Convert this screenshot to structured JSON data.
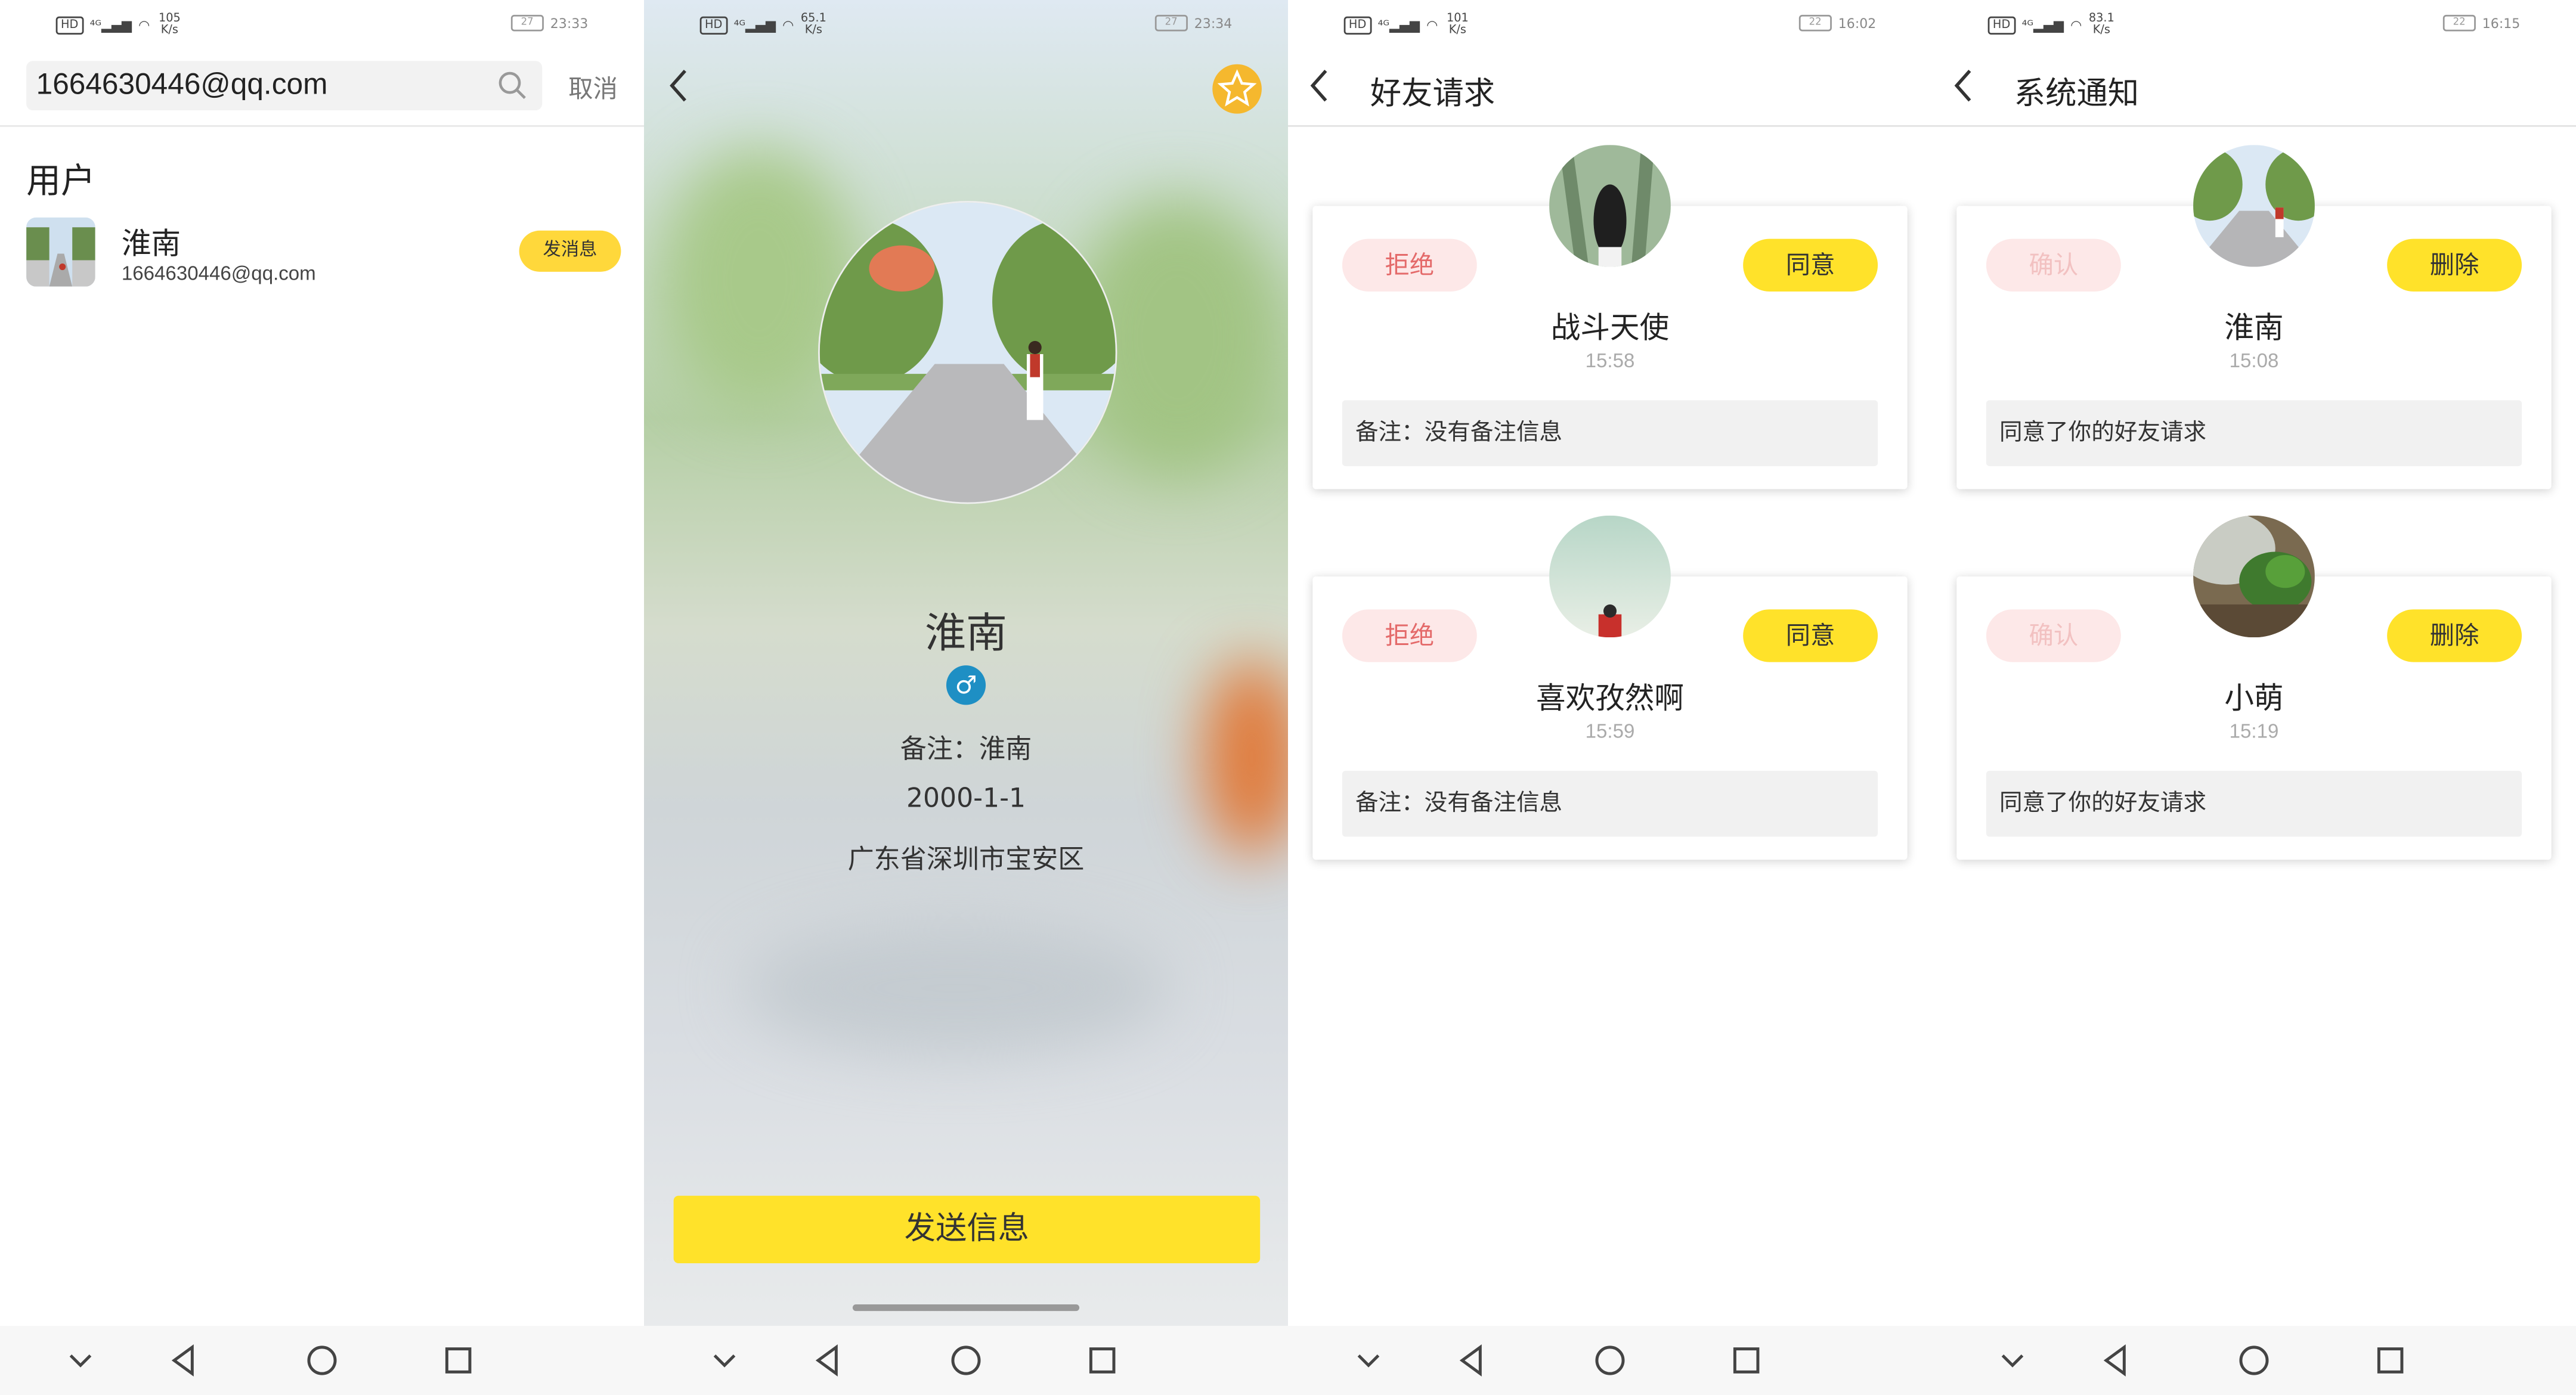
{
  "status_bars": [
    {
      "net_speed": "105",
      "net_unit": "K/s",
      "battery": "27",
      "time": "23:33"
    },
    {
      "net_speed": "65.1",
      "net_unit": "K/s",
      "battery": "27",
      "time": "23:34"
    },
    {
      "net_speed": "101",
      "net_unit": "K/s",
      "battery": "22",
      "time": "16:02"
    },
    {
      "net_speed": "83.1",
      "net_unit": "K/s",
      "battery": "22",
      "time": "16:15"
    }
  ],
  "search_screen": {
    "query": "1664630446@qq.com",
    "cancel_label": "取消",
    "section_title": "用户",
    "result": {
      "name": "淮南",
      "email": "1664630446@qq.com",
      "action_label": "发消息"
    }
  },
  "profile_screen": {
    "name": "淮南",
    "gender_symbol": "♂",
    "remark": "备注：淮南",
    "birthday": "2000-1-1",
    "location": "广东省深圳市宝安区",
    "send_label": "发送信息"
  },
  "friend_requests": {
    "title": "好友请求",
    "reject_label": "拒绝",
    "accept_label": "同意",
    "items": [
      {
        "name": "战斗天使",
        "time": "15:58",
        "note": "备注：没有备注信息"
      },
      {
        "name": "喜欢孜然啊",
        "time": "15:59",
        "note": "备注：没有备注信息"
      }
    ]
  },
  "system_notices": {
    "title": "系统通知",
    "confirm_label": "确认",
    "delete_label": "删除",
    "items": [
      {
        "name": "淮南",
        "time": "15:08",
        "note": "同意了你的好友请求"
      },
      {
        "name": "小萌",
        "time": "15:19",
        "note": "同意了你的好友请求"
      }
    ]
  },
  "colors": {
    "accent_yellow": "#ffe22a",
    "reject_pink": "#fde8e8",
    "reject_text": "#e46a6a",
    "gender_blue": "#1e8fc4"
  },
  "icons": [
    "search-icon",
    "back-icon",
    "star-icon",
    "male-icon",
    "nav-down-icon",
    "nav-back-icon",
    "nav-home-icon",
    "nav-recent-icon"
  ]
}
